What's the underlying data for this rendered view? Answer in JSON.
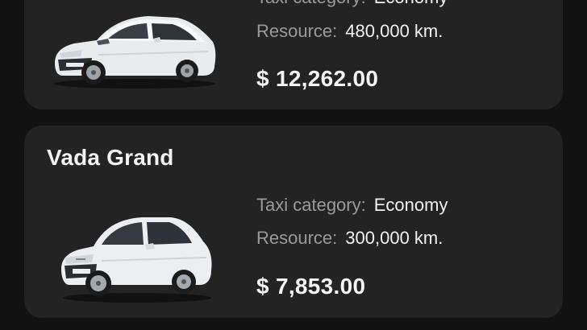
{
  "cars": [
    {
      "title": "",
      "category_label": "Taxi category:",
      "category_value": "Economy",
      "resource_label": "Resource:",
      "resource_value": "480,000 km.",
      "price": "$ 12,262.00"
    },
    {
      "title": "Vada Grand",
      "category_label": "Taxi category:",
      "category_value": "Economy",
      "resource_label": "Resource:",
      "resource_value": "300,000 km.",
      "price": "$ 7,853.00"
    }
  ],
  "colors": {
    "background": "#121212",
    "card": "#232323",
    "label": "#9a9a9a",
    "text": "#f2f2f2"
  },
  "icons": [
    "sedan-car-image",
    "hatch-sedan-car-image"
  ]
}
